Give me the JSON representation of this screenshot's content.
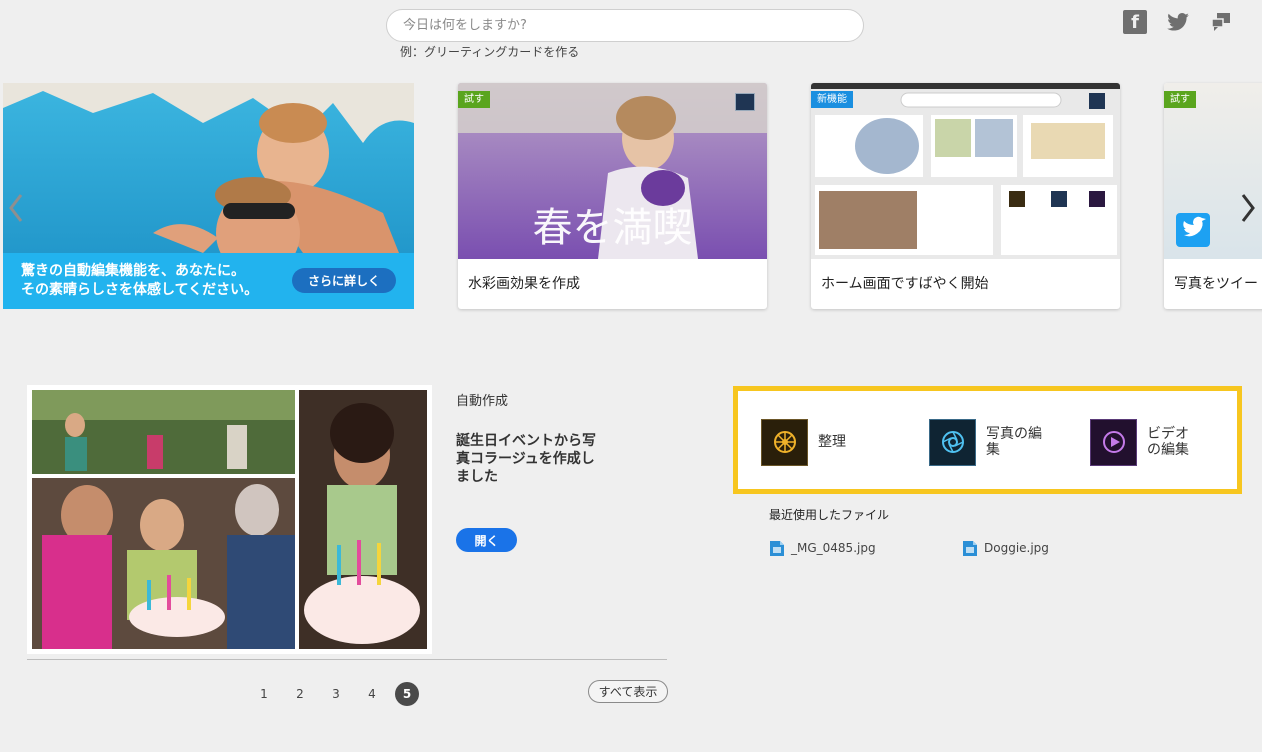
{
  "search": {
    "placeholder": "今日は何をしますか?",
    "example": "例：グリーティングカードを作る"
  },
  "social": {
    "facebook_icon": "facebook-icon",
    "twitter_icon": "twitter-icon",
    "share_icon": "share-icon"
  },
  "carousel": {
    "hero": {
      "text_line1": "驚きの自動編集機能を、あなたに。",
      "text_line2": "その素晴らしさを体感してください。",
      "button": "さらに詳しく"
    },
    "cards": [
      {
        "badge": "試す",
        "label": "水彩画効果を作成",
        "overlay": "春を満喫"
      },
      {
        "badge": "新機能",
        "label": "ホーム画面ですばやく開始"
      },
      {
        "badge": "試す",
        "label": "写真をツイート"
      }
    ]
  },
  "auto_creation": {
    "title": "自動作成",
    "description": "誕生日イベントから写真コラージュを作成しました",
    "open_button": "開く"
  },
  "pager": {
    "pages": [
      "1",
      "2",
      "3",
      "4",
      "5"
    ],
    "current": "5",
    "show_all": "すべて表示"
  },
  "launcher": {
    "organize": "整理",
    "photo_edit": "写真の編集",
    "video_edit": "ビデオの編集"
  },
  "recent": {
    "title": "最近使用したファイル",
    "files": [
      "_MG_0485.jpg",
      "Doggie.jpg"
    ]
  },
  "colors": {
    "accent_yellow": "#f7c61f",
    "badge_green": "#5aa51e",
    "badge_blue": "#1a8fe0",
    "open_button": "#1a73e8"
  }
}
